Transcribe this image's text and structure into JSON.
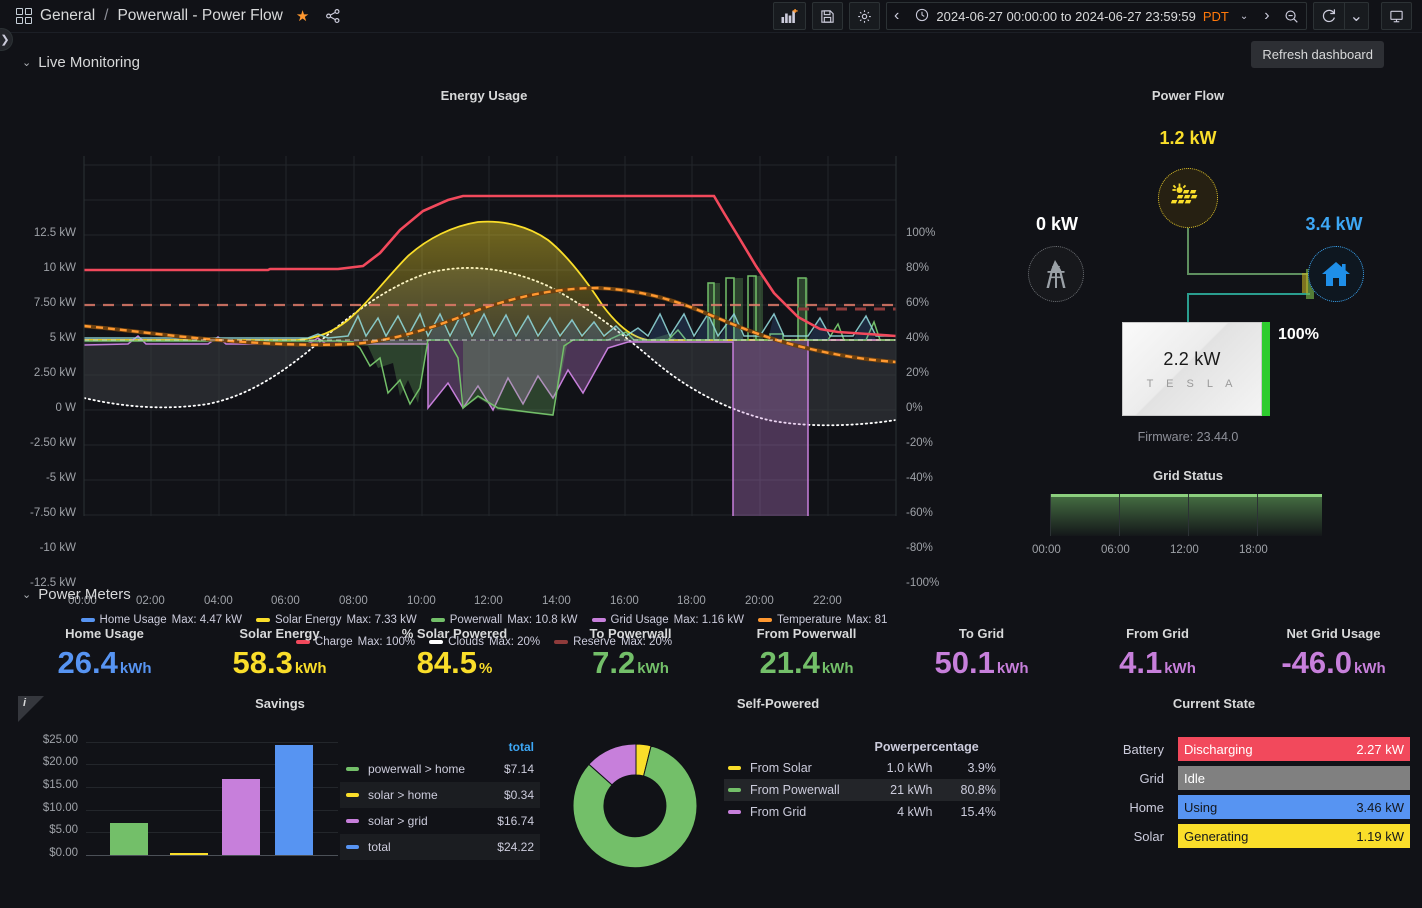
{
  "topnav": {
    "grid_icon": "dashboards-grid-icon",
    "breadcrumb_root": "General",
    "breadcrumb_sep": "/",
    "breadcrumb_current": "Powerwall - Power Flow",
    "star_icon": "star-filled-icon",
    "share_icon": "share-nodes-icon",
    "add_panel_icon": "add-panel-icon",
    "save_icon": "save-dashboard-icon",
    "settings_icon": "gear-icon",
    "time_prev_icon": "‹",
    "clock_icon": "clock-icon",
    "time_range": "2024-06-27 00:00:00 to 2024-06-27 23:59:59",
    "timezone": "PDT",
    "time_chevron": "⌄",
    "time_next_icon": "›",
    "zoom_out_icon": "zoom-out-icon",
    "refresh_icon": "refresh-icon",
    "refresh_chevron": "⌄",
    "kiosk_icon": "tv-kiosk-icon",
    "tooltip": "Refresh dashboard",
    "edge_expander_icon": "❯"
  },
  "rows": {
    "live_monitoring": "Live Monitoring",
    "power_meters": "Power Meters",
    "chevron": "⌄"
  },
  "energy_usage": {
    "title": "Energy Usage",
    "left_axis_ticks": [
      "12.5 kW",
      "10 kW",
      "7.50 kW",
      "5 kW",
      "2.50 kW",
      "0 W",
      "-2.50 kW",
      "-5 kW",
      "-7.50 kW",
      "-10 kW",
      "-12.5 kW"
    ],
    "right_axis_ticks": [
      "100%",
      "80%",
      "60%",
      "40%",
      "20%",
      "0%",
      "-20%",
      "-40%",
      "-60%",
      "-80%",
      "-100%"
    ],
    "x_axis_ticks": [
      "00:00",
      "02:00",
      "04:00",
      "06:00",
      "08:00",
      "10:00",
      "12:00",
      "14:00",
      "16:00",
      "18:00",
      "20:00",
      "22:00"
    ],
    "legend": [
      {
        "name": "Home Usage",
        "max": "Max: 4.47 kW",
        "color": "#5794f2"
      },
      {
        "name": "Solar Energy",
        "max": "Max: 7.33 kW",
        "color": "#fade2a"
      },
      {
        "name": "Powerwall",
        "max": "Max: 10.8 kW",
        "color": "#73bf69"
      },
      {
        "name": "Grid Usage",
        "max": "Max: 1.16 kW",
        "color": "#c77fdb"
      },
      {
        "name": "Temperature",
        "max": "Max: 81",
        "color": "#ff9830"
      },
      {
        "name": "Charge",
        "max": "Max: 100%",
        "color": "#f2495c"
      },
      {
        "name": "Clouds",
        "max": "Max: 20%",
        "color": "#ffffff"
      },
      {
        "name": "Reserve",
        "max": "Max: 20%",
        "color": "#8f3b3b"
      }
    ]
  },
  "chart_data": [
    {
      "type": "line",
      "title": "Energy Usage",
      "xlabel": "",
      "ylabel": "kW",
      "ylim": [
        -12.5,
        12.5
      ],
      "y2lim": [
        -100,
        100
      ],
      "grid": true,
      "legend": "bottom",
      "x": [
        "00:00",
        "02:00",
        "04:00",
        "06:00",
        "08:00",
        "10:00",
        "12:00",
        "14:00",
        "16:00",
        "18:00",
        "20:00",
        "22:00"
      ],
      "series": [
        {
          "name": "Home Usage",
          "color": "#5794f2",
          "max": 4.47,
          "unit": "kW"
        },
        {
          "name": "Solar Energy",
          "color": "#fade2a",
          "max": 7.33,
          "unit": "kW"
        },
        {
          "name": "Powerwall",
          "color": "#73bf69",
          "max": 10.8,
          "unit": "kW"
        },
        {
          "name": "Grid Usage",
          "color": "#c77fdb",
          "max": 1.16,
          "unit": "kW"
        },
        {
          "name": "Temperature",
          "color": "#ff9830",
          "max": 81,
          "unit": ""
        },
        {
          "name": "Charge",
          "color": "#f2495c",
          "max": 100,
          "unit": "%"
        },
        {
          "name": "Clouds",
          "color": "#ffffff",
          "max": 20,
          "unit": "%"
        },
        {
          "name": "Reserve",
          "color": "#8f3b3b",
          "max": 20,
          "unit": "%"
        }
      ]
    },
    {
      "type": "bar",
      "title": "Savings",
      "categories": [
        "powerwall > home",
        "solar > home",
        "solar > grid",
        "total"
      ],
      "values": [
        7.14,
        0.34,
        16.74,
        24.22
      ],
      "colors": [
        "#73bf69",
        "#fade2a",
        "#c77fdb",
        "#5794f2"
      ],
      "ylabel": "",
      "ylim": [
        0,
        25
      ],
      "ytick_labels": [
        "$0.00",
        "$5.00",
        "$10.00",
        "$15.00",
        "$20.00",
        "$25.00"
      ],
      "legend": "right"
    },
    {
      "type": "pie",
      "title": "Self-Powered",
      "categories": [
        "From Solar",
        "From Powerwall",
        "From Grid"
      ],
      "values": [
        1.0,
        21,
        4
      ],
      "percentages": [
        3.9,
        80.8,
        15.4
      ],
      "colors": [
        "#fade2a",
        "#73bf69",
        "#c77fdb"
      ],
      "legend": "right"
    }
  ],
  "power_flow": {
    "title": "Power Flow",
    "solar_value": "1.2 kW",
    "solar_icon": "solar-panel-icon",
    "grid_value": "0 kW",
    "grid_icon": "transmission-tower-icon",
    "home_value": "3.4 kW",
    "home_icon": "house-icon",
    "battery_value": "2.2 kW",
    "battery_brand": "T E S L A",
    "battery_soc": "100%",
    "firmware": "Firmware: 23.44.0",
    "colors": {
      "solar": "#fade2a",
      "home": "#3da7f5",
      "grid": "#d8d9da",
      "battery": "#2ecc2e"
    }
  },
  "grid_status": {
    "title": "Grid Status",
    "x_ticks": [
      "00:00",
      "06:00",
      "12:00",
      "18:00"
    ],
    "color": "#8ccf7e"
  },
  "power_meters": [
    {
      "title": "Home Usage",
      "value": "26.4",
      "unit": "kWh",
      "color": "#5794f2"
    },
    {
      "title": "Solar Energy",
      "value": "58.3",
      "unit": "kWh",
      "color": "#fade2a"
    },
    {
      "title": "% Solar Powered",
      "value": "84.5",
      "unit": "%",
      "color": "#fade2a"
    },
    {
      "title": "To Powerwall",
      "value": "7.2",
      "unit": "kWh",
      "color": "#73bf69"
    },
    {
      "title": "From Powerwall",
      "value": "21.4",
      "unit": "kWh",
      "color": "#73bf69"
    },
    {
      "title": "To Grid",
      "value": "50.1",
      "unit": "kWh",
      "color": "#c77fdb"
    },
    {
      "title": "From Grid",
      "value": "4.1",
      "unit": "kWh",
      "color": "#c77fdb"
    },
    {
      "title": "Net Grid Usage",
      "value": "-46.0",
      "unit": "kWh",
      "color": "#c77fdb"
    }
  ],
  "savings": {
    "title": "Savings",
    "info_icon": "panel-info-icon",
    "y_ticks": [
      "$25.00",
      "$20.00",
      "$15.00",
      "$10.00",
      "$5.00",
      "$0.00"
    ],
    "legend_header": "total",
    "rows": [
      {
        "name": "powerwall > home",
        "amount": "$7.14",
        "color": "#73bf69"
      },
      {
        "name": "solar > home",
        "amount": "$0.34",
        "color": "#fade2a"
      },
      {
        "name": "solar > grid",
        "amount": "$16.74",
        "color": "#c77fdb"
      },
      {
        "name": "total",
        "amount": "$24.22",
        "color": "#5794f2"
      }
    ]
  },
  "self_powered": {
    "title": "Self-Powered",
    "col_power": "Power",
    "col_percentage": "percentage",
    "rows": [
      {
        "name": "From Solar",
        "power": "1.0 kWh",
        "percentage": "3.9%",
        "color": "#fade2a"
      },
      {
        "name": "From Powerwall",
        "power": "21 kWh",
        "percentage": "80.8%",
        "color": "#73bf69"
      },
      {
        "name": "From Grid",
        "power": "4 kWh",
        "percentage": "15.4%",
        "color": "#c77fdb"
      }
    ]
  },
  "current_state": {
    "title": "Current State",
    "rows": [
      {
        "label": "Battery",
        "state": "Discharging",
        "value": "2.27 kW",
        "bg": "#f2495c",
        "fg": "#ffffff"
      },
      {
        "label": "Grid",
        "state": "Idle",
        "value": "",
        "bg": "#808080",
        "fg": "#ffffff"
      },
      {
        "label": "Home",
        "state": "Using",
        "value": "3.46 kW",
        "bg": "#5794f2",
        "fg": "#1a1a1a"
      },
      {
        "label": "Solar",
        "state": "Generating",
        "value": "1.19 kW",
        "bg": "#fade2a",
        "fg": "#1a1a1a"
      }
    ]
  }
}
